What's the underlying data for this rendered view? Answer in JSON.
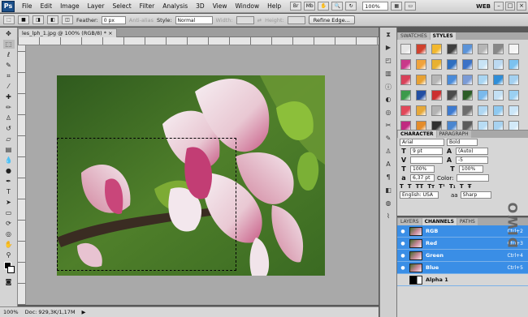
{
  "app": {
    "logo": "Ps",
    "workspace": "WEB"
  },
  "menu": [
    "File",
    "Edit",
    "Image",
    "Layer",
    "Select",
    "Filter",
    "Analysis",
    "3D",
    "View",
    "Window",
    "Help"
  ],
  "zoom": "100%",
  "options": {
    "feather_label": "Feather:",
    "feather_value": "0 px",
    "antialias_label": "Anti-alias",
    "style_label": "Style:",
    "style_value": "Normal",
    "width_label": "Width:",
    "height_label": "Height:",
    "refine_label": "Refine Edge..."
  },
  "document": {
    "tab": "les_lph_1.jpg @ 100% (RGB/8) *"
  },
  "status": {
    "zoom": "100%",
    "doc": "Doc: 929,3K/1,17M"
  },
  "panels": {
    "swatches_tab": "SWATCHES",
    "styles_tab": "STYLES",
    "character_tab": "CHARACTER",
    "paragraph_tab": "PARAGRAPH",
    "font": "Arial",
    "style": "Bold",
    "size": "9 pt",
    "leading": "(Auto)",
    "tracking": "-5",
    "vscale": "100%",
    "hscale": "100%",
    "baseline": "6,37 pt",
    "color_label": "Color:",
    "language": "English: USA",
    "aa": "Sharp",
    "layers_tab": "LAYERS",
    "channels_tab": "CHANNELS",
    "paths_tab": "PATHS"
  },
  "channels": [
    {
      "name": "RGB",
      "shortcut": "Ctrl+2"
    },
    {
      "name": "Red",
      "shortcut": "Ctrl+3"
    },
    {
      "name": "Green",
      "shortcut": "Ctrl+4"
    },
    {
      "name": "Blue",
      "shortcut": "Ctrl+5"
    },
    {
      "name": "Alpha 1",
      "shortcut": ""
    }
  ],
  "style_colors": [
    "#e6e6e6",
    "#d0422e",
    "#f2b72e",
    "#3f3f3f",
    "#5b93d8",
    "#b5b5b5",
    "#888",
    "#f4f4f4",
    "#c93a8a",
    "#f0a33b",
    "#e8b130",
    "#2e6fc0",
    "#3b72c7",
    "#c8e3f5",
    "#bcd9f1",
    "#7cc2ef",
    "#d8425a",
    "#e7a132",
    "#b6b6b6",
    "#4a8bd9",
    "#7a9bd6",
    "#a9d5f2",
    "#2f8ed8",
    "#a3d0f0",
    "#3b9a4a",
    "#234fa3",
    "#cc2f2f",
    "#4b4b4b",
    "#2b5c26",
    "#7ab9ec",
    "#c3e0f4",
    "#9ad0f2",
    "#e1485a",
    "#e6a839",
    "#b3b3b3",
    "#3d7ad0",
    "#6c6c6c",
    "#b0d7f2",
    "#8fc9f0",
    "#cbe6f8",
    "#c02a80",
    "#e48c2a",
    "#2f2f2f",
    "#4b86cf",
    "#5a5a5a",
    "#b8dcf4",
    "#a7d2f0",
    "#d2e9f8",
    "#d94f3f",
    "#f0c060",
    "#7a7a7a",
    "#3572c8",
    "#2b5fb3",
    "#9fcff0",
    "#82c3ee",
    "#bde0f6"
  ],
  "watermark": "DIWO"
}
